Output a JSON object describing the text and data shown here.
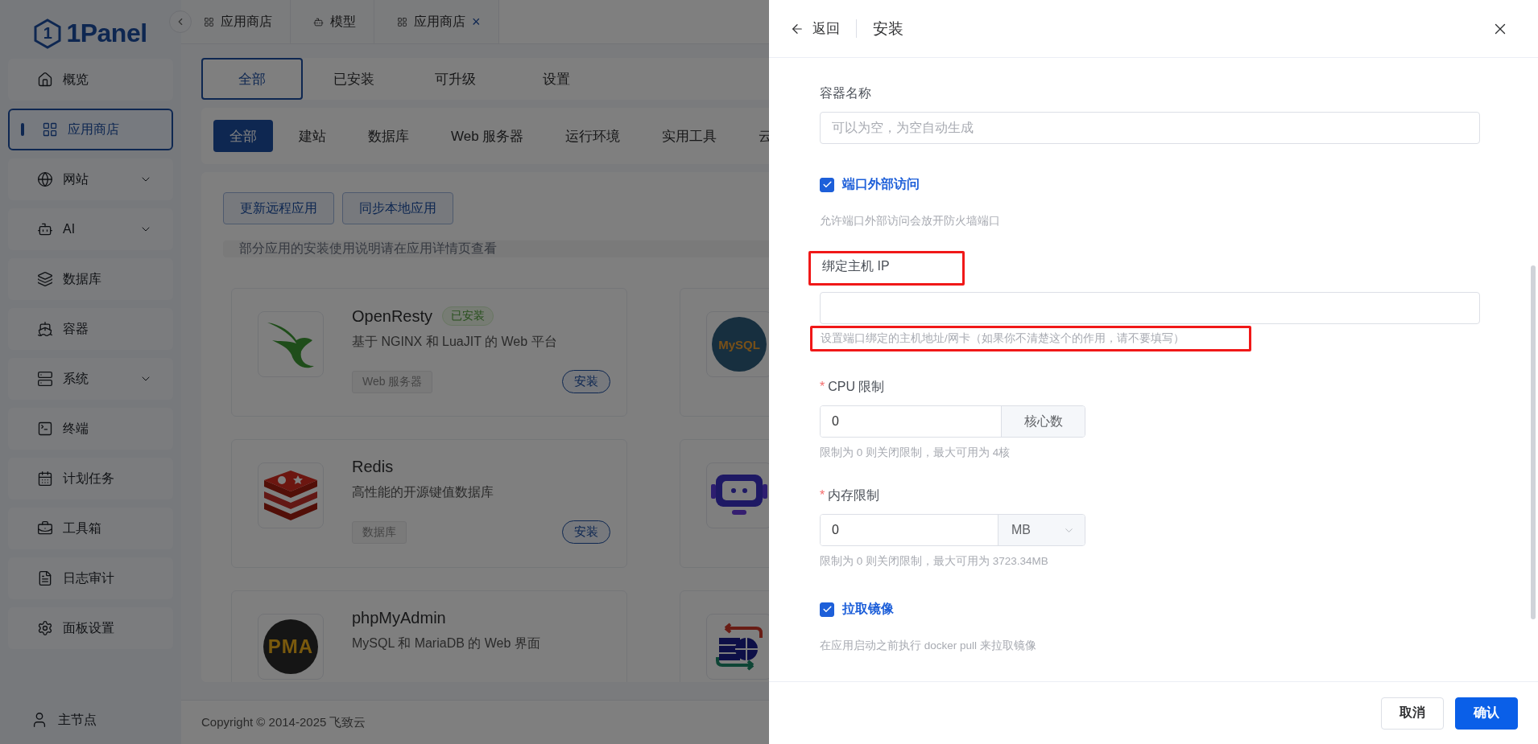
{
  "sidebar": {
    "logo_mark": "1",
    "logo": "1Panel",
    "items": [
      {
        "label": "概览",
        "selected": false,
        "has_submenu": false
      },
      {
        "label": "应用商店",
        "selected": true,
        "has_submenu": false
      },
      {
        "label": "网站",
        "selected": false,
        "has_submenu": true
      },
      {
        "label": "AI",
        "selected": false,
        "has_submenu": true
      },
      {
        "label": "数据库",
        "selected": false,
        "has_submenu": false
      },
      {
        "label": "容器",
        "selected": false,
        "has_submenu": false
      },
      {
        "label": "系统",
        "selected": false,
        "has_submenu": true
      },
      {
        "label": "终端",
        "selected": false,
        "has_submenu": false
      },
      {
        "label": "计划任务",
        "selected": false,
        "has_submenu": false
      },
      {
        "label": "工具箱",
        "selected": false,
        "has_submenu": false
      },
      {
        "label": "日志审计",
        "selected": false,
        "has_submenu": false
      },
      {
        "label": "面板设置",
        "selected": false,
        "has_submenu": false
      }
    ],
    "node": "主节点"
  },
  "tabs": [
    {
      "label": "应用商店"
    },
    {
      "label": "模型"
    },
    {
      "label": "应用商店",
      "close": "×"
    }
  ],
  "view_tabs": [
    {
      "label": "全部",
      "selected": true
    },
    {
      "label": "已安装",
      "selected": false
    },
    {
      "label": "可升级",
      "selected": false
    },
    {
      "label": "设置",
      "selected": false
    }
  ],
  "categories": [
    {
      "label": "全部",
      "selected": true
    },
    {
      "label": "建站",
      "selected": false
    },
    {
      "label": "数据库",
      "selected": false
    },
    {
      "label": "Web 服务器",
      "selected": false
    },
    {
      "label": "运行环境",
      "selected": false
    },
    {
      "label": "实用工具",
      "selected": false
    },
    {
      "label": "云",
      "selected": false
    }
  ],
  "actions": [
    "更新远程应用",
    "同步本地应用"
  ],
  "notice": "部分应用的安装使用说明请在应用详情页查看",
  "apps": [
    {
      "kind": "full",
      "name": "OpenResty",
      "badge": "已安装",
      "description": "基于 NGINX 和 LuaJIT 的 Web 平台",
      "tag": "Web 服务器",
      "action": "安装"
    },
    {
      "kind": "logo",
      "logo_text": "MySQL"
    },
    {
      "kind": "full",
      "name": "Redis",
      "description": "高性能的开源键值数据库",
      "tag": "数据库",
      "action": "安装"
    },
    {
      "kind": "logo"
    },
    {
      "kind": "full",
      "name": "phpMyAdmin",
      "description": "MySQL 和 MariaDB 的 Web 界面",
      "logo_text": "PMA"
    },
    {
      "kind": "logo"
    }
  ],
  "footer": "Copyright © 2014-2025 飞致云",
  "drawer": {
    "back": "返回",
    "title": "安装",
    "fields": [
      {
        "kind": "input",
        "label": "容器名称",
        "placeholder": "可以为空，为空自动生成",
        "highlighted": false
      },
      {
        "kind": "checkbox",
        "label": "端口外部访问",
        "checked": true,
        "help": "允许端口外部访问会放开防火墙端口"
      },
      {
        "kind": "input",
        "label": "绑定主机 IP",
        "help": "设置端口绑定的主机地址/网卡（如果你不清楚这个的作用，请不要填写）",
        "highlighted": true
      },
      {
        "kind": "addon",
        "required_mark": "*",
        "label": "CPU 限制",
        "value": "0",
        "addon": "核心数",
        "help": "限制为 0 则关闭限制，最大可用为 4核"
      },
      {
        "kind": "select",
        "required_mark": "*",
        "label": "内存限制",
        "value": "0",
        "unit": "MB",
        "help": "限制为 0 则关闭限制，最大可用为 3723.34MB"
      },
      {
        "kind": "checkbox",
        "label": "拉取镜像",
        "checked": true,
        "help": "在应用启动之前执行 docker pull 来拉取镜像"
      }
    ],
    "buttons": [
      {
        "label": "取消",
        "primary": false
      },
      {
        "label": "确认",
        "primary": true
      }
    ]
  }
}
